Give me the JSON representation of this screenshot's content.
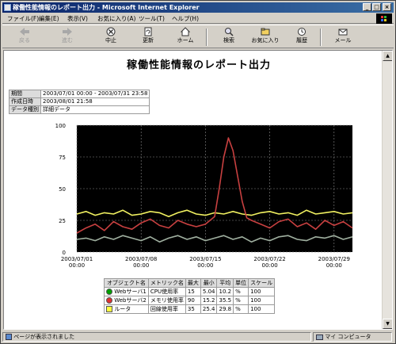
{
  "window": {
    "title": "稼働性能情報のレポート出力 - Microsoft Internet Explorer"
  },
  "menu": [
    "ファイル(F)",
    "編集(E)",
    "表示(V)",
    "お気に入り(A)",
    "ツール(T)",
    "ヘルプ(H)"
  ],
  "toolbar": {
    "back": "戻る",
    "forward": "進む",
    "stop": "中止",
    "refresh": "更新",
    "home": "ホーム",
    "search": "検索",
    "favorites": "お気に入り",
    "history": "履歴",
    "mail": "メール"
  },
  "page": {
    "title": "稼働性能情報のレポート出力",
    "info": {
      "period_label": "期間",
      "period_value": "2003/07/01 00:00 - 2003/07/31 23:58",
      "created_label": "作成日時",
      "created_value": "2003/08/01 21:58",
      "type_label": "データ種別",
      "type_value": "詳細データ"
    },
    "legend": {
      "headers": [
        "オブジェクト名",
        "メトリック名",
        "最大",
        "最小",
        "平均",
        "単位",
        "スケール"
      ],
      "rows": [
        {
          "name": "Webサーバ1",
          "metric": "CPU使用率",
          "max": "15",
          "min": "5.04",
          "avg": "10.2",
          "unit": "%",
          "scale": "100",
          "color": "#00a000",
          "marker": "circle"
        },
        {
          "name": "Webサーバ2",
          "metric": "メモリ使用率",
          "max": "90",
          "min": "15.2",
          "avg": "35.5",
          "unit": "%",
          "scale": "100",
          "color": "#e03030",
          "marker": "circle"
        },
        {
          "name": "ルータ",
          "metric": "回線使用率",
          "max": "35",
          "min": "25.4",
          "avg": "29.8",
          "unit": "%",
          "scale": "100",
          "color": "#ffff40",
          "marker": "square"
        }
      ]
    }
  },
  "status": {
    "message": "ページが表示されました",
    "zone": "マイ コンピュータ"
  },
  "chart_data": {
    "type": "line",
    "title": "",
    "ylim": [
      0,
      100
    ],
    "yticks": [
      "0",
      "25",
      "50",
      "75",
      "100"
    ],
    "xlim": [
      0,
      30
    ],
    "xticks": [
      {
        "date": "2003/07/01",
        "time": "00:00",
        "day": 0
      },
      {
        "date": "2003/07/08",
        "time": "00:00",
        "day": 7
      },
      {
        "date": "2003/07/15",
        "time": "00:00",
        "day": 14
      },
      {
        "date": "2003/07/22",
        "time": "00:00",
        "day": 21
      },
      {
        "date": "2003/07/29",
        "time": "00:00",
        "day": 28
      }
    ],
    "grid": true,
    "background": "#000000",
    "series": [
      {
        "name": "ルータ",
        "color": "#f0f060",
        "x": [
          0,
          1,
          2,
          3,
          4,
          5,
          6,
          7,
          8,
          9,
          10,
          11,
          12,
          13,
          14,
          15,
          16,
          17,
          18,
          19,
          20,
          21,
          22,
          23,
          24,
          25,
          26,
          27,
          28,
          29,
          30
        ],
        "y": [
          30,
          32,
          29,
          31,
          30,
          33,
          29,
          30,
          32,
          31,
          28,
          31,
          33,
          30,
          29,
          31,
          30,
          32,
          30,
          29,
          31,
          32,
          30,
          31,
          29,
          33,
          30,
          31,
          32,
          30,
          31
        ]
      },
      {
        "name": "Webサーバ2",
        "color": "#c84040",
        "x": [
          0,
          1,
          2,
          3,
          4,
          5,
          6,
          7,
          8,
          9,
          10,
          11,
          12,
          13,
          14,
          15,
          15.5,
          16,
          16.5,
          17,
          17.5,
          18,
          18.5,
          19,
          20,
          21,
          22,
          23,
          24,
          25,
          26,
          27,
          28,
          29,
          30
        ],
        "y": [
          15,
          19,
          22,
          17,
          24,
          20,
          18,
          23,
          26,
          21,
          19,
          25,
          22,
          20,
          22,
          28,
          50,
          75,
          90,
          80,
          60,
          40,
          27,
          25,
          22,
          19,
          24,
          26,
          20,
          23,
          18,
          25,
          21,
          24,
          19
        ]
      },
      {
        "name": "Webサーバ1",
        "color": "#a0b0a0",
        "x": [
          0,
          1,
          2,
          3,
          4,
          5,
          6,
          7,
          8,
          9,
          10,
          11,
          12,
          13,
          14,
          15,
          16,
          17,
          18,
          19,
          20,
          21,
          22,
          23,
          24,
          25,
          26,
          27,
          28,
          29,
          30
        ],
        "y": [
          10,
          11,
          9,
          12,
          10,
          13,
          11,
          9,
          12,
          8,
          11,
          13,
          10,
          12,
          9,
          11,
          13,
          10,
          12,
          8,
          11,
          9,
          12,
          13,
          10,
          9,
          12,
          11,
          13,
          10,
          12
        ]
      }
    ]
  }
}
